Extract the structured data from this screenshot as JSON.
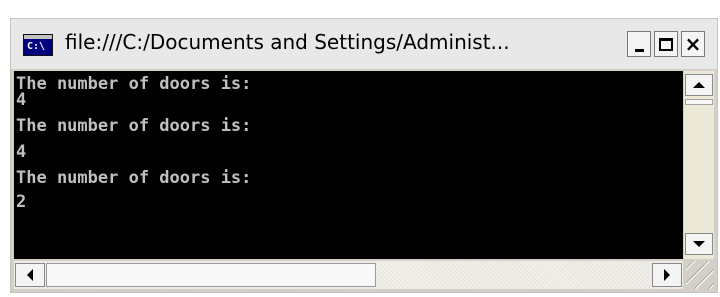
{
  "window": {
    "title": "file:///C:/Documents and Settings/Administ...",
    "icon_name": "console-app-icon",
    "icon_text": "C:\\"
  },
  "controls": {
    "minimize_icon": "minimize-icon",
    "maximize_icon": "maximize-icon",
    "close_icon": "close-icon",
    "close_glyph": "×"
  },
  "console": {
    "background": "#000000",
    "text_color": "#c0c0c0",
    "lines": [
      "The number of doors is:",
      "4",
      "The number of doors is:",
      "4",
      "The number of doors is:",
      "2"
    ]
  },
  "scrollbars": {
    "vertical": [
      "scroll-up-icon",
      "scroll-down-icon"
    ],
    "horizontal": [
      "scroll-left-icon",
      "scroll-right-icon"
    ]
  }
}
